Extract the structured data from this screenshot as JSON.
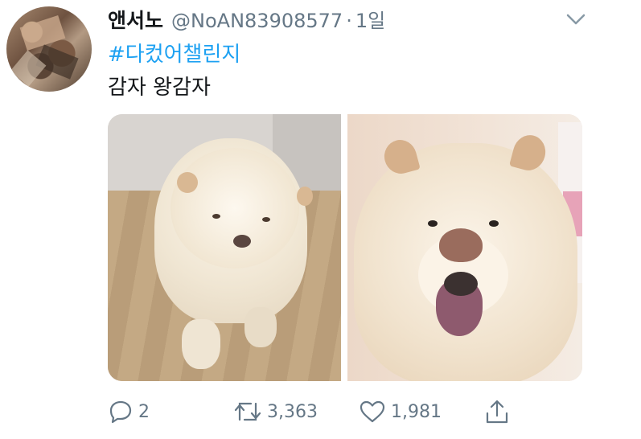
{
  "tweet": {
    "display_name": "앤서노",
    "handle": "@NoAN83908577",
    "separator": "·",
    "time": "1일",
    "hashtag": "#다컸어챌린지",
    "text": "감자 왕감자"
  },
  "actions": {
    "reply_count": "2",
    "retweet_count": "3,363",
    "like_count": "1,981"
  },
  "icons": [
    "chevron-down-icon",
    "reply-icon",
    "retweet-icon",
    "like-icon",
    "share-icon"
  ],
  "colors": {
    "link": "#1da1f2",
    "secondary_text": "#657786",
    "primary_text": "#14171a"
  }
}
